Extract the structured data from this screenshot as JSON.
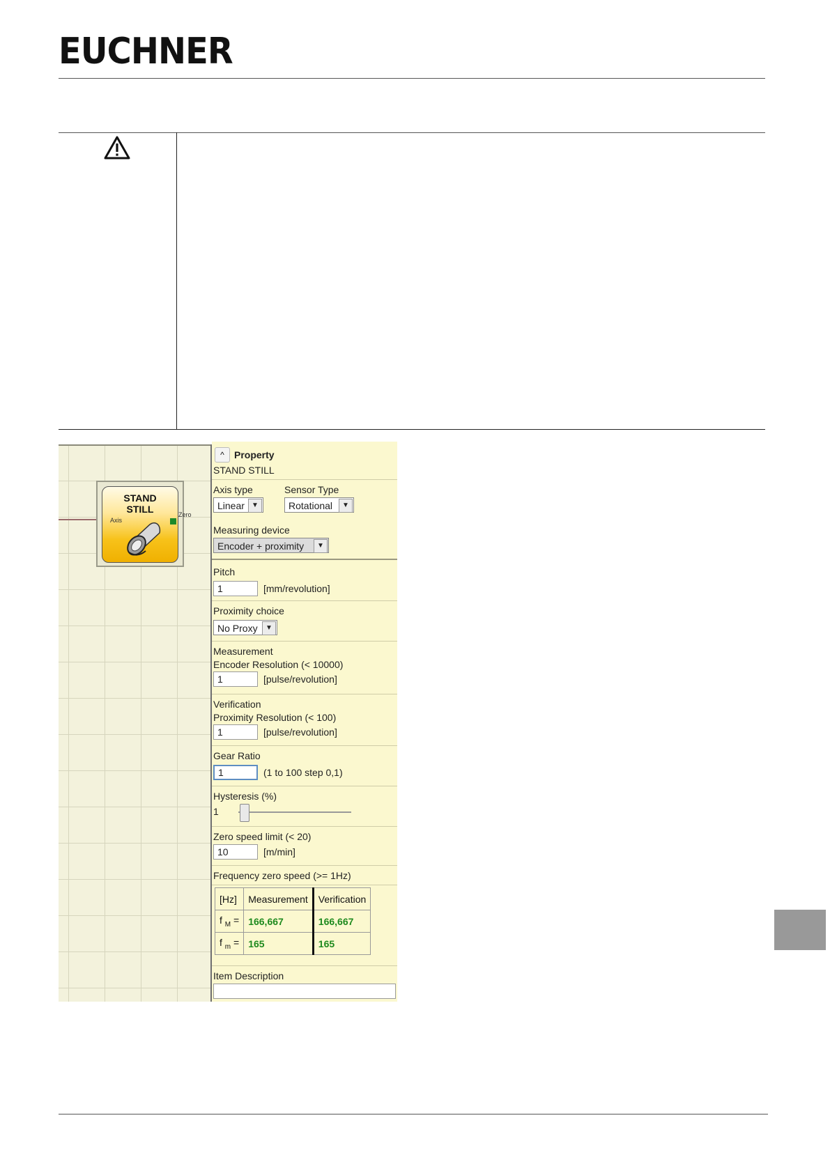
{
  "header": {
    "logo_text": "EUCHNER"
  },
  "warning": {
    "icon": "warning-triangle-icon"
  },
  "block": {
    "title_line1": "STAND",
    "title_line2": "STILL",
    "input_label": "Axis",
    "output_label": "Zero"
  },
  "property_panel": {
    "header": "Property",
    "name": "STAND STILL",
    "axis_type": {
      "label": "Axis type",
      "value": "Linear"
    },
    "sensor_type": {
      "label": "Sensor Type",
      "value": "Rotational"
    },
    "measuring_device": {
      "label": "Measuring device",
      "value": "Encoder + proximity"
    },
    "pitch": {
      "label": "Pitch",
      "value": "1",
      "unit": "[mm/revolution]"
    },
    "proximity_choice": {
      "label": "Proximity choice",
      "value": "No Proxy"
    },
    "measurement": {
      "label": "Measurement",
      "sublabel": "Encoder Resolution  (< 10000)",
      "value": "1",
      "unit": "[pulse/revolution]"
    },
    "verification": {
      "label": "Verification",
      "sublabel": "Proximity Resolution  (< 100)",
      "value": "1",
      "unit": "[pulse/revolution]"
    },
    "gear_ratio": {
      "label": "Gear Ratio",
      "value": "1",
      "unit": "(1 to 100 step 0,1)"
    },
    "hysteresis": {
      "label": "Hysteresis (%)",
      "value": "1",
      "level_percent": 1
    },
    "zero_speed_limit": {
      "label": "Zero speed limit  (< 20)",
      "value": "10",
      "unit": "[m/min]"
    },
    "frequency": {
      "label": "Frequency zero speed (>= 1Hz)",
      "headers": [
        "[Hz]",
        "Measurement",
        "Verification"
      ],
      "rows": [
        {
          "symbol": "f",
          "sub": "M",
          "eq": "=",
          "measurement": "166,667",
          "verification": "166,667"
        },
        {
          "symbol": "f",
          "sub": "m",
          "eq": "=",
          "measurement": "165",
          "verification": "165"
        }
      ]
    },
    "item_description": {
      "label": "Item Description",
      "value": ""
    }
  }
}
